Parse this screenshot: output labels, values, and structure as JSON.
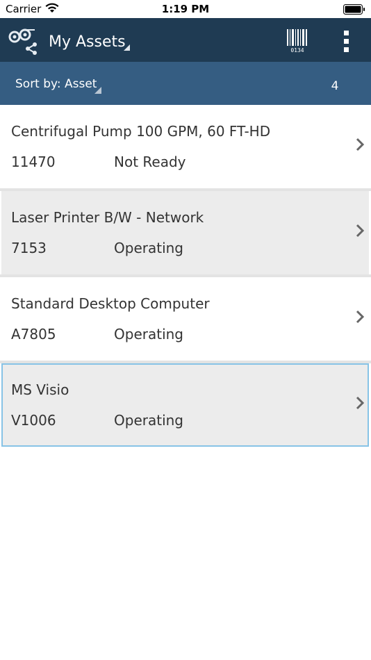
{
  "status_bar": {
    "carrier": "Carrier",
    "time": "1:19 PM"
  },
  "header": {
    "title": "My Assets",
    "icons": [
      "asset-logo-icon",
      "barcode-icon",
      "more-vertical-icon"
    ],
    "barcode_digits": "0134"
  },
  "sort_bar": {
    "label": "Sort by: Asset",
    "count": "4"
  },
  "assets": [
    {
      "name": "Centrifugal Pump 100 GPM, 60 FT-HD",
      "id": "11470",
      "status": "Not Ready"
    },
    {
      "name": "Laser Printer B/W - Network",
      "id": "7153",
      "status": "Operating"
    },
    {
      "name": "Standard Desktop Computer",
      "id": "A7805",
      "status": "Operating"
    },
    {
      "name": "MS Visio",
      "id": "V1006",
      "status": "Operating"
    }
  ],
  "colors": {
    "header": "#1f3b53",
    "sort_bar": "#355d82",
    "row_alt": "#ececec",
    "selected_border": "#87c3e6"
  }
}
